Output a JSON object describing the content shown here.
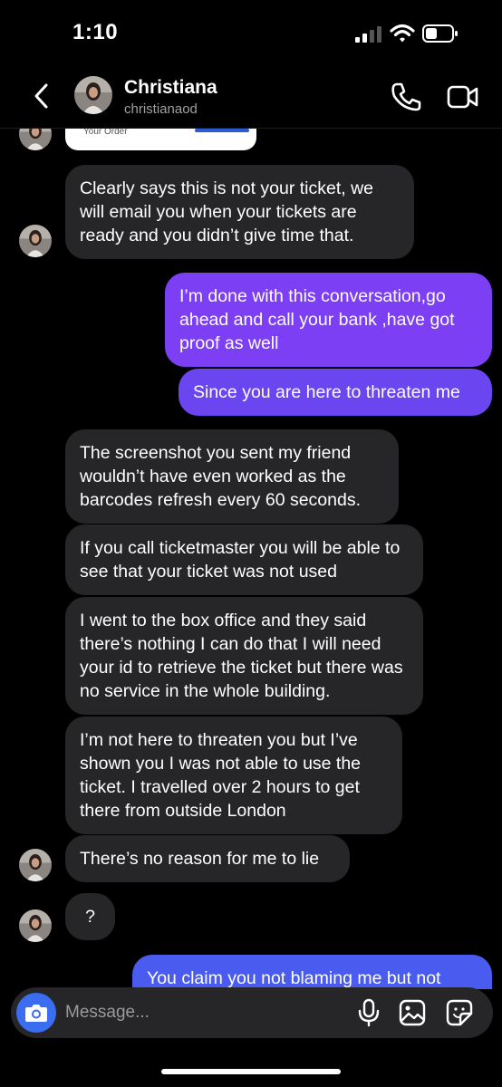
{
  "status_bar": {
    "time": "1:10",
    "signal_icon": "cellular-signal-icon",
    "wifi_icon": "wifi-icon",
    "battery_icon": "battery-icon"
  },
  "header": {
    "contact_name": "Christiana",
    "username": "christianaod",
    "back_icon": "chevron-left-icon",
    "call_icon": "phone-icon",
    "video_icon": "video-camera-icon"
  },
  "shared_card": {
    "text": "Your Order"
  },
  "messages": [
    {
      "direction": "incoming",
      "text": "Clearly says this is not your ticket, we will email you when your tickets are ready and you didn’t give time that."
    },
    {
      "direction": "outgoing",
      "text": "I’m done with this conversation,go ahead and call your bank ,have got proof as well"
    },
    {
      "direction": "outgoing",
      "text": "Since you are here to threaten me"
    },
    {
      "direction": "incoming",
      "text": "The screenshot you sent my friend wouldn’t have even worked as the barcodes refresh every 60 seconds."
    },
    {
      "direction": "incoming",
      "text": "If you call ticketmaster you will be able to see that your ticket was not used"
    },
    {
      "direction": "incoming",
      "text": "I went to the box office and they said there’s nothing I can do that I will need your id to retrieve the ticket but there was no service in the whole building."
    },
    {
      "direction": "incoming",
      "text": "I’m not here to threaten you but I’ve shown you I was not able to use the ticket. I travelled over 2 hours to get there from outside London"
    },
    {
      "direction": "incoming",
      "text": "There’s no reason for me to lie"
    },
    {
      "direction": "incoming",
      "text": "?"
    },
    {
      "direction": "outgoing",
      "text": "You claim you not blaming me but not"
    }
  ],
  "composer": {
    "placeholder": "Message...",
    "camera_icon": "camera-icon",
    "mic_icon": "microphone-icon",
    "gallery_icon": "image-gallery-icon",
    "sticker_icon": "sticker-icon"
  },
  "colors": {
    "background": "#000000",
    "incoming_bubble": "#262628",
    "outgoing_purple": "#7c3ff3",
    "outgoing_purple_2": "#6a45f0",
    "outgoing_blue": "#4a5cf0",
    "camera_button": "#3a6df0"
  }
}
